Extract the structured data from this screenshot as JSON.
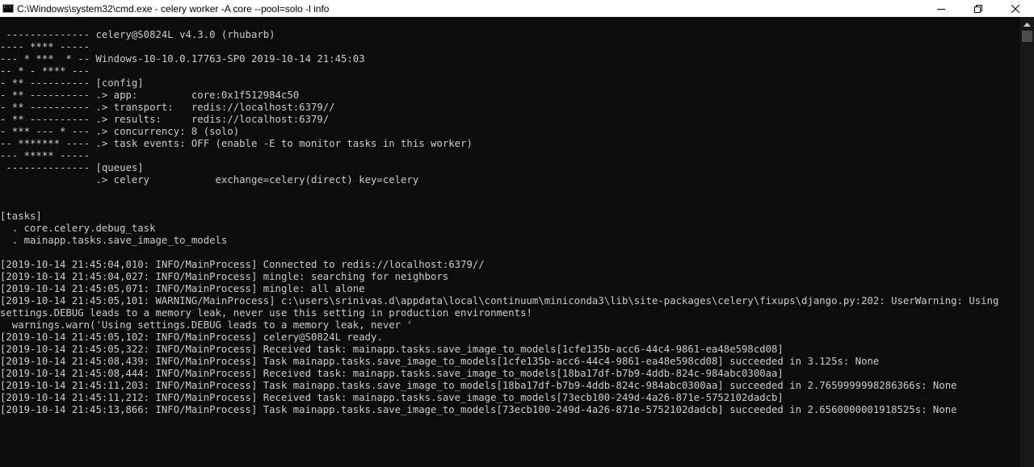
{
  "window": {
    "title": "C:\\Windows\\system32\\cmd.exe - celery  worker -A core --pool=solo -l info",
    "icon_label": "C:\\",
    "controls": [
      "minimize-icon",
      "maximize-icon",
      "close-icon"
    ]
  },
  "console": {
    "lines": [
      " -------------- celery@S0824L v4.3.0 (rhubarb)",
      "---- **** -----",
      "--- * ***  * -- Windows-10-10.0.17763-SP0 2019-10-14 21:45:03",
      "-- * - **** ---",
      "- ** ---------- [config]",
      "- ** ---------- .> app:         core:0x1f512984c50",
      "- ** ---------- .> transport:   redis://localhost:6379//",
      "- ** ---------- .> results:     redis://localhost:6379/",
      "- *** --- * --- .> concurrency: 8 (solo)",
      "-- ******* ---- .> task events: OFF (enable -E to monitor tasks in this worker)",
      "--- ***** -----",
      " -------------- [queues]",
      "                .> celery           exchange=celery(direct) key=celery",
      "",
      "",
      "[tasks]",
      "  . core.celery.debug_task",
      "  . mainapp.tasks.save_image_to_models",
      "",
      "[2019-10-14 21:45:04,010: INFO/MainProcess] Connected to redis://localhost:6379//",
      "[2019-10-14 21:45:04,027: INFO/MainProcess] mingle: searching for neighbors",
      "[2019-10-14 21:45:05,071: INFO/MainProcess] mingle: all alone",
      "[2019-10-14 21:45:05,101: WARNING/MainProcess] c:\\users\\srinivas.d\\appdata\\local\\continuum\\miniconda3\\lib\\site-packages\\celery\\fixups\\django.py:202: UserWarning: Using",
      "settings.DEBUG leads to a memory leak, never use this setting in production environments!",
      "  warnings.warn('Using settings.DEBUG leads to a memory leak, never '",
      "[2019-10-14 21:45:05,102: INFO/MainProcess] celery@S0824L ready.",
      "[2019-10-14 21:45:05,322: INFO/MainProcess] Received task: mainapp.tasks.save_image_to_models[1cfe135b-acc6-44c4-9861-ea48e598cd08]",
      "[2019-10-14 21:45:08,439: INFO/MainProcess] Task mainapp.tasks.save_image_to_models[1cfe135b-acc6-44c4-9861-ea48e598cd08] succeeded in 3.125s: None",
      "[2019-10-14 21:45:08,444: INFO/MainProcess] Received task: mainapp.tasks.save_image_to_models[18ba17df-b7b9-4ddb-824c-984abc0300aa]",
      "[2019-10-14 21:45:11,203: INFO/MainProcess] Task mainapp.tasks.save_image_to_models[18ba17df-b7b9-4ddb-824c-984abc0300aa] succeeded in 2.7659999998286366s: None",
      "[2019-10-14 21:45:11,212: INFO/MainProcess] Received task: mainapp.tasks.save_image_to_models[73ecb100-249d-4a26-871e-5752102dadcb]",
      "[2019-10-14 21:45:13,866: INFO/MainProcess] Task mainapp.tasks.save_image_to_models[73ecb100-249d-4a26-871e-5752102dadcb] succeeded in 2.6560000001918525s: None"
    ]
  },
  "scrollbar": {
    "arrow_icon": "scroll-up-arrow-icon"
  },
  "colors": {
    "console_bg": "#0c0c0c",
    "console_text": "#cccccc",
    "titlebar_bg": "#ffffff",
    "scrollbar_bg": "#171717",
    "scroll_thumb": "#4d4d4d"
  }
}
